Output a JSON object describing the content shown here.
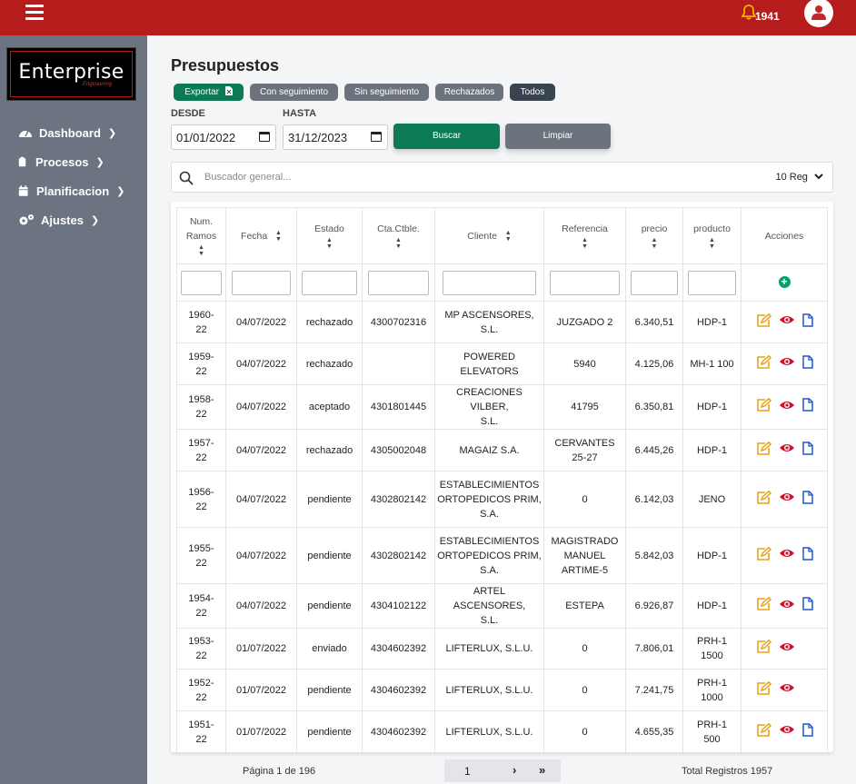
{
  "topbar": {
    "notification_count": "1941"
  },
  "brand": {
    "name": "Enterprise",
    "sub": "Engineering"
  },
  "sidebar": {
    "items": [
      {
        "label": "Dashboard"
      },
      {
        "label": "Procesos"
      },
      {
        "label": "Planificacion"
      },
      {
        "label": "Ajustes"
      }
    ]
  },
  "page": {
    "title": "Presupuestos"
  },
  "filters": {
    "export_label": "Exportar",
    "con_seguimiento": "Con seguimiento",
    "sin_seguimiento": "Sin seguimiento",
    "rechazados": "Rechazados",
    "todos": "Todos",
    "desde_label": "DESDE",
    "hasta_label": "HASTA",
    "desde_value": "01/01/2022",
    "hasta_value": "31/12/2023",
    "buscar": "Buscar",
    "limpiar": "Limpiar"
  },
  "search": {
    "placeholder": "Buscador general...",
    "page_size": "10 Reg"
  },
  "table": {
    "headers": {
      "num_a": "Num.",
      "num_b": "Ramos",
      "fecha": "Fecha",
      "estado": "Estado",
      "cta": "Cta.Ctble.",
      "cliente": "Cliente",
      "referencia": "Referencia",
      "precio": "precio",
      "producto": "producto",
      "acciones": "Acciones"
    },
    "rows": [
      {
        "num_a": "1960-",
        "num_b": "22",
        "fecha": "04/07/2022",
        "estado": "rechazado",
        "cta": "4300702316",
        "cliente_a": "MP ASCENSORES,",
        "cliente_b": "S.L.",
        "cliente_c": "",
        "ref_a": "JUZGADO 2",
        "ref_b": "",
        "ref_c": "",
        "precio": "6.340,51",
        "prod_a": "HDP-1",
        "prod_b": ""
      },
      {
        "num_a": "1959-",
        "num_b": "22",
        "fecha": "04/07/2022",
        "estado": "rechazado",
        "cta": "",
        "cliente_a": "POWERED",
        "cliente_b": "ELEVATORS",
        "cliente_c": "",
        "ref_a": "5940",
        "ref_b": "",
        "ref_c": "",
        "precio": "4.125,06",
        "prod_a": "MH-1 100",
        "prod_b": ""
      },
      {
        "num_a": "1958-",
        "num_b": "22",
        "fecha": "04/07/2022",
        "estado": "aceptado",
        "cta": "4301801445",
        "cliente_a": "CREACIONES VILBER,",
        "cliente_b": "S.L.",
        "cliente_c": "",
        "ref_a": "41795",
        "ref_b": "",
        "ref_c": "",
        "precio": "6.350,81",
        "prod_a": "HDP-1",
        "prod_b": ""
      },
      {
        "num_a": "1957-",
        "num_b": "22",
        "fecha": "04/07/2022",
        "estado": "rechazado",
        "cta": "4305002048",
        "cliente_a": "MAGAIZ S.A.",
        "cliente_b": "",
        "cliente_c": "",
        "ref_a": "CERVANTES",
        "ref_b": "25-27",
        "ref_c": "",
        "precio": "6.445,26",
        "prod_a": "HDP-1",
        "prod_b": ""
      },
      {
        "num_a": "1956-",
        "num_b": "22",
        "fecha": "04/07/2022",
        "estado": "pendiente",
        "cta": "4302802142",
        "cliente_a": "ESTABLECIMIENTOS",
        "cliente_b": "ORTOPEDICOS PRIM,",
        "cliente_c": "S.A.",
        "ref_a": "0",
        "ref_b": "",
        "ref_c": "",
        "precio": "6.142,03",
        "prod_a": "JENO",
        "prod_b": ""
      },
      {
        "num_a": "1955-",
        "num_b": "22",
        "fecha": "04/07/2022",
        "estado": "pendiente",
        "cta": "4302802142",
        "cliente_a": "ESTABLECIMIENTOS",
        "cliente_b": "ORTOPEDICOS PRIM,",
        "cliente_c": "S.A.",
        "ref_a": "MAGISTRADO",
        "ref_b": "MANUEL",
        "ref_c": "ARTIME-5",
        "precio": "5.842,03",
        "prod_a": "HDP-1",
        "prod_b": ""
      },
      {
        "num_a": "1954-",
        "num_b": "22",
        "fecha": "04/07/2022",
        "estado": "pendiente",
        "cta": "4304102122",
        "cliente_a": "ARTEL ASCENSORES,",
        "cliente_b": "S.L.",
        "cliente_c": "",
        "ref_a": "ESTEPA",
        "ref_b": "",
        "ref_c": "",
        "precio": "6.926,87",
        "prod_a": "HDP-1",
        "prod_b": ""
      },
      {
        "num_a": "1953-",
        "num_b": "22",
        "fecha": "01/07/2022",
        "estado": "enviado",
        "cta": "4304602392",
        "cliente_a": "LIFTERLUX, S.L.U.",
        "cliente_b": "",
        "cliente_c": "",
        "ref_a": "0",
        "ref_b": "",
        "ref_c": "",
        "precio": "7.806,01",
        "prod_a": "PRH-1",
        "prod_b": "1500"
      },
      {
        "num_a": "1952-",
        "num_b": "22",
        "fecha": "01/07/2022",
        "estado": "pendiente",
        "cta": "4304602392",
        "cliente_a": "LIFTERLUX, S.L.U.",
        "cliente_b": "",
        "cliente_c": "",
        "ref_a": "0",
        "ref_b": "",
        "ref_c": "",
        "precio": "7.241,75",
        "prod_a": "PRH-1",
        "prod_b": "1000"
      },
      {
        "num_a": "1951-",
        "num_b": "22",
        "fecha": "01/07/2022",
        "estado": "pendiente",
        "cta": "4304602392",
        "cliente_a": "LIFTERLUX, S.L.U.",
        "cliente_b": "",
        "cliente_c": "",
        "ref_a": "0",
        "ref_b": "",
        "ref_c": "",
        "precio": "4.655,35",
        "prod_a": "PRH-1",
        "prod_b": "500"
      }
    ]
  },
  "pagination": {
    "page_text": "Página 1 de 196",
    "current": "1",
    "next": "›",
    "last": "»",
    "total": "Total Registros 1957"
  },
  "colors": {
    "topbar": "#b71c1c",
    "sidebar": "#6c7482",
    "primary_green": "#0b7a55",
    "grey_btn": "#6c737d",
    "dark_btn": "#3a4350",
    "edit_icon": "#e8a317",
    "view_icon": "#d0102a",
    "doc_icon": "#1e56d6",
    "add_icon": "#00a36c"
  }
}
